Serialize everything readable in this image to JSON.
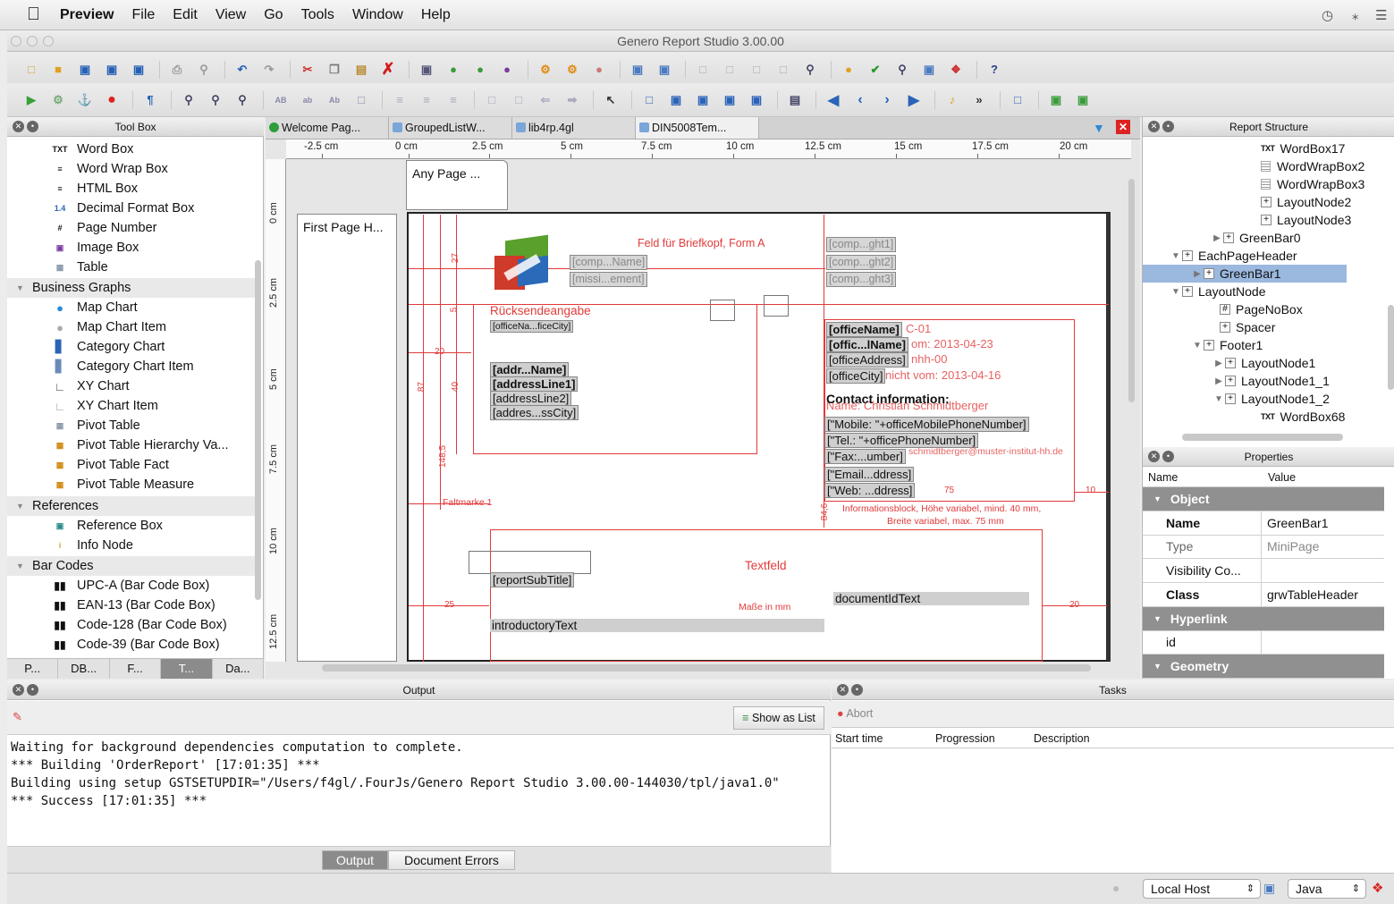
{
  "menubar": {
    "app": "Preview",
    "items": [
      "File",
      "Edit",
      "View",
      "Go",
      "Tools",
      "Window",
      "Help"
    ]
  },
  "window": {
    "title": "Genero Report Studio 3.00.00"
  },
  "toolbox": {
    "title": "Tool Box",
    "items": [
      {
        "label": "Word Box",
        "icon": "word-box-icon"
      },
      {
        "label": "Word Wrap Box",
        "icon": "word-wrap-box-icon"
      },
      {
        "label": "HTML Box",
        "icon": "html-box-icon"
      },
      {
        "label": "Decimal Format Box",
        "icon": "decimal-format-box-icon"
      },
      {
        "label": "Page Number",
        "icon": "page-number-icon"
      },
      {
        "label": "Image Box",
        "icon": "image-box-icon"
      },
      {
        "label": "Table",
        "icon": "table-icon"
      }
    ],
    "cat_business": "Business Graphs",
    "business": [
      {
        "label": "Map Chart",
        "icon": "map-chart-icon"
      },
      {
        "label": "Map Chart Item",
        "icon": "map-chart-item-icon"
      },
      {
        "label": "Category Chart",
        "icon": "category-chart-icon"
      },
      {
        "label": "Category Chart Item",
        "icon": "category-chart-item-icon"
      },
      {
        "label": "XY Chart",
        "icon": "xy-chart-icon"
      },
      {
        "label": "XY Chart Item",
        "icon": "xy-chart-item-icon"
      },
      {
        "label": "Pivot Table",
        "icon": "pivot-table-icon"
      },
      {
        "label": "Pivot Table Hierarchy Va...",
        "icon": "pivot-hierarchy-icon"
      },
      {
        "label": "Pivot Table Fact",
        "icon": "pivot-fact-icon"
      },
      {
        "label": "Pivot Table Measure",
        "icon": "pivot-measure-icon"
      }
    ],
    "cat_refs": "References",
    "refs": [
      {
        "label": "Reference Box",
        "icon": "reference-box-icon"
      },
      {
        "label": "Info Node",
        "icon": "info-node-icon"
      }
    ],
    "cat_barcodes": "Bar Codes",
    "barcodes": [
      {
        "label": "UPC-A (Bar Code Box)",
        "icon": "barcode-icon"
      },
      {
        "label": "EAN-13 (Bar Code Box)",
        "icon": "barcode-icon"
      },
      {
        "label": "Code-128 (Bar Code Box)",
        "icon": "barcode-icon"
      },
      {
        "label": "Code-39 (Bar Code Box)",
        "icon": "barcode-icon"
      }
    ],
    "tabs": [
      "P...",
      "DB...",
      "F...",
      "T...",
      "Da..."
    ]
  },
  "doctabs": [
    "Welcome Pag...",
    "GroupedListW...",
    "lib4rp.4gl",
    "DIN5008Tem..."
  ],
  "ruler": {
    "h": [
      "-2.5 cm",
      "0 cm",
      "2.5 cm",
      "5 cm",
      "7.5 cm",
      "10 cm",
      "12.5 cm",
      "15 cm",
      "17.5 cm",
      "20 cm"
    ],
    "v": [
      "0 cm",
      "2.5 cm",
      "5 cm",
      "7.5 cm",
      "10 cm",
      "12.5 cm"
    ]
  },
  "design": {
    "anyPage": "Any Page ...",
    "firstPage": "First Page H...",
    "feld": "Feld für Briefkopf, Form A",
    "companyName": "[comp...Name]",
    "mission": "[missi...ement]",
    "right1": "[comp...ght1]",
    "right2": "[comp...ght2]",
    "right3": "[comp...ght3]",
    "ruecksende": "Rücksendeangabe",
    "officeCity": "[officeNa...ficeCity]",
    "addrName": "[addr...Name]",
    "addrLine1": "[addressLine1]",
    "addrLine2": "[addressLine2]",
    "addrCity": "[addres...ssCity]",
    "officeName": "[officeName]",
    "officINName": "[offic...lName]",
    "officeAddress": "[officeAddress]",
    "officeCityR": "[officeCity]",
    "ghost1": "C-01",
    "ghost2": "om: 2013-04-23",
    "ghost3": "nhh-00",
    "ghost4": "nicht vom: 2013-04-16",
    "contact": "Contact information:",
    "ghostName": "Name: Christian Schmidtberger",
    "mobile": "[\"Mobile: \"+officeMobilePhoneNumber]",
    "tel": "[\"Tel.: \"+officePhoneNumber]",
    "fax": "[\"Fax:...umber]",
    "ghostMail": "schmidtberger@muster-institut-hh.de",
    "email": "[\"Email...ddress]",
    "web": "[\"Web: ...ddress]",
    "dim75": "75",
    "dim10": "10",
    "info1": "Informationsblock, Höhe variabel, mind. 40 mm,",
    "info2": "Breite variabel, max. 75 mm",
    "faltmarke": "Faltmarke 1",
    "textfeld": "Textfeld",
    "subtitle": "[reportSubTitle]",
    "docId": "documentIdText",
    "masse": "Maße in mm",
    "intro": "introductoryText",
    "d27": "27",
    "d5": "5",
    "d20": "20",
    "d87": "87",
    "d40": "40",
    "d1485": "148,5",
    "d25": "25",
    "d20b": "20",
    "d84": "84,6"
  },
  "structure": {
    "title": "Report Structure",
    "nodes": [
      {
        "label": "WordBox17",
        "indent": 118,
        "kind": "txt",
        "arrow": ""
      },
      {
        "label": "WordWrapBox2",
        "indent": 118,
        "kind": "wrap",
        "arrow": ""
      },
      {
        "label": "WordWrapBox3",
        "indent": 118,
        "kind": "wrap",
        "arrow": ""
      },
      {
        "label": "LayoutNode2",
        "indent": 118,
        "kind": "box",
        "arrow": ""
      },
      {
        "label": "LayoutNode3",
        "indent": 118,
        "kind": "box",
        "arrow": ""
      },
      {
        "label": "GreenBar0",
        "indent": 76,
        "kind": "box",
        "arrow": "▶"
      },
      {
        "label": "EachPageHeader",
        "indent": 30,
        "kind": "box",
        "arrow": "▼"
      },
      {
        "label": "GreenBar1",
        "indent": 54,
        "kind": "box",
        "arrow": "▶"
      },
      {
        "label": "LayoutNode",
        "indent": 30,
        "kind": "box",
        "arrow": "▼"
      },
      {
        "label": "PageNoBox",
        "indent": 72,
        "kind": "pg",
        "arrow": ""
      },
      {
        "label": "Spacer",
        "indent": 72,
        "kind": "box",
        "arrow": ""
      },
      {
        "label": "Footer1",
        "indent": 54,
        "kind": "box",
        "arrow": "▼"
      },
      {
        "label": "LayoutNode1",
        "indent": 78,
        "kind": "box",
        "arrow": "▶"
      },
      {
        "label": "LayoutNode1_1",
        "indent": 78,
        "kind": "box",
        "arrow": "▶"
      },
      {
        "label": "LayoutNode1_2",
        "indent": 78,
        "kind": "box",
        "arrow": "▼"
      },
      {
        "label": "WordBox68",
        "indent": 118,
        "kind": "txt",
        "arrow": ""
      }
    ]
  },
  "properties": {
    "title": "Properties",
    "col_name": "Name",
    "col_value": "Value",
    "rows": [
      {
        "k": "Object",
        "v": "",
        "cat": true
      },
      {
        "k": "Name",
        "v": "GreenBar1",
        "bold": true
      },
      {
        "k": "Type",
        "v": "MiniPage",
        "grey": true
      },
      {
        "k": "Visibility Co...",
        "v": ""
      },
      {
        "k": "Class",
        "v": "grwTableHeader",
        "bold": true
      },
      {
        "k": "Hyperlink",
        "v": "",
        "cat": true
      },
      {
        "k": "id",
        "v": ""
      },
      {
        "k": "Geometry",
        "v": "",
        "cat": true
      }
    ]
  },
  "output": {
    "title": "Output",
    "show_as_list": "Show as List",
    "lines": [
      "Waiting for background dependencies computation to complete.",
      "*** Building 'OrderReport' [17:01:35] ***",
      "Building using setup GSTSETUPDIR=\"/Users/f4gl/.FourJs/Genero Report Studio 3.00.00-144030/tpl/java1.0\"",
      "*** Success [17:01:35] ***"
    ],
    "tab_output": "Output",
    "tab_errors": "Document Errors"
  },
  "tasks": {
    "title": "Tasks",
    "abort": "Abort",
    "col_start": "Start time",
    "col_prog": "Progression",
    "col_desc": "Description"
  },
  "status": {
    "host": "Local Host",
    "lang": "Java"
  },
  "colors": {
    "accent": "#e23a3a",
    "selection": "#9bb8de"
  }
}
